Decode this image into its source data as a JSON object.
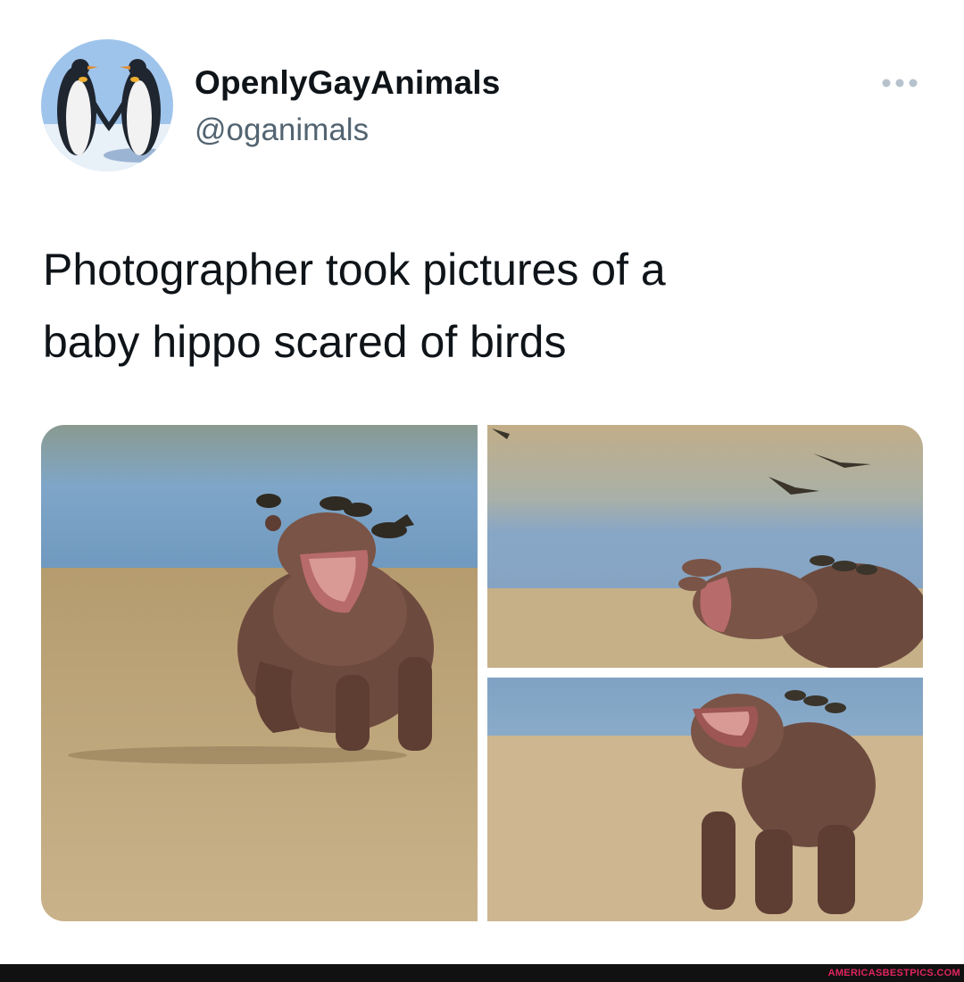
{
  "tweet": {
    "author": {
      "display_name": "OpenlyGayAnimals",
      "handle": "@oganimals",
      "avatar_icon": "penguins-avatar"
    },
    "more_icon": "more-options-icon",
    "text": "Photographer took pictures of a\nbaby hippo scared of birds",
    "media": [
      {
        "icon": "hippo-photo-running"
      },
      {
        "icon": "hippo-photo-birds-flying"
      },
      {
        "icon": "hippo-photo-front-view"
      }
    ]
  },
  "footer": {
    "watermark": "AMERICASBESTPICS.COM"
  },
  "colors": {
    "text_primary": "#0f1419",
    "text_secondary": "#536471",
    "watermark": "#e0245e"
  }
}
